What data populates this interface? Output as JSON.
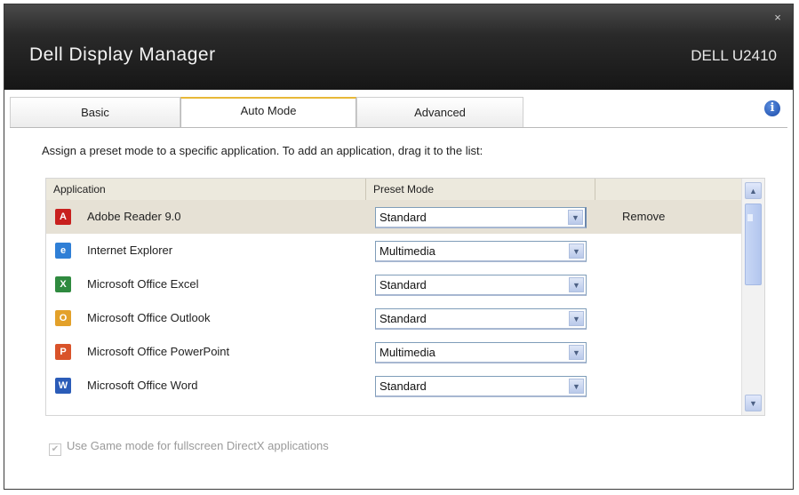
{
  "window": {
    "title": "Dell Display Manager",
    "model": "DELL U2410",
    "close_glyph": "×"
  },
  "tabs": [
    {
      "label": "Basic",
      "active": false
    },
    {
      "label": "Auto Mode",
      "active": true
    },
    {
      "label": "Advanced",
      "active": false
    }
  ],
  "info_glyph": "i",
  "instructions": "Assign a preset mode to a specific application. To add an application, drag it to the list:",
  "table": {
    "headers": {
      "application": "Application",
      "preset_mode": "Preset Mode",
      "action": ""
    },
    "rows": [
      {
        "name": "Adobe Reader 9.0",
        "mode": "Standard",
        "action": "Remove",
        "icon": "adobe-reader-icon",
        "icon_color": "#c8201e",
        "icon_glyph": "A",
        "selected": true
      },
      {
        "name": "Internet Explorer",
        "mode": "Multimedia",
        "action": "",
        "icon": "internet-explorer-icon",
        "icon_color": "#2f7fd6",
        "icon_glyph": "e",
        "selected": false
      },
      {
        "name": "Microsoft Office Excel",
        "mode": "Standard",
        "action": "",
        "icon": "excel-icon",
        "icon_color": "#2f8a3f",
        "icon_glyph": "X",
        "selected": false
      },
      {
        "name": "Microsoft Office Outlook",
        "mode": "Standard",
        "action": "",
        "icon": "outlook-icon",
        "icon_color": "#e3a12a",
        "icon_glyph": "O",
        "selected": false
      },
      {
        "name": "Microsoft Office PowerPoint",
        "mode": "Multimedia",
        "action": "",
        "icon": "powerpoint-icon",
        "icon_color": "#d9532a",
        "icon_glyph": "P",
        "selected": false
      },
      {
        "name": "Microsoft Office Word",
        "mode": "Standard",
        "action": "",
        "icon": "word-icon",
        "icon_color": "#2b5cb8",
        "icon_glyph": "W",
        "selected": false
      }
    ]
  },
  "game_mode": {
    "label": "Use Game mode for fullscreen DirectX applications",
    "checked": true
  }
}
